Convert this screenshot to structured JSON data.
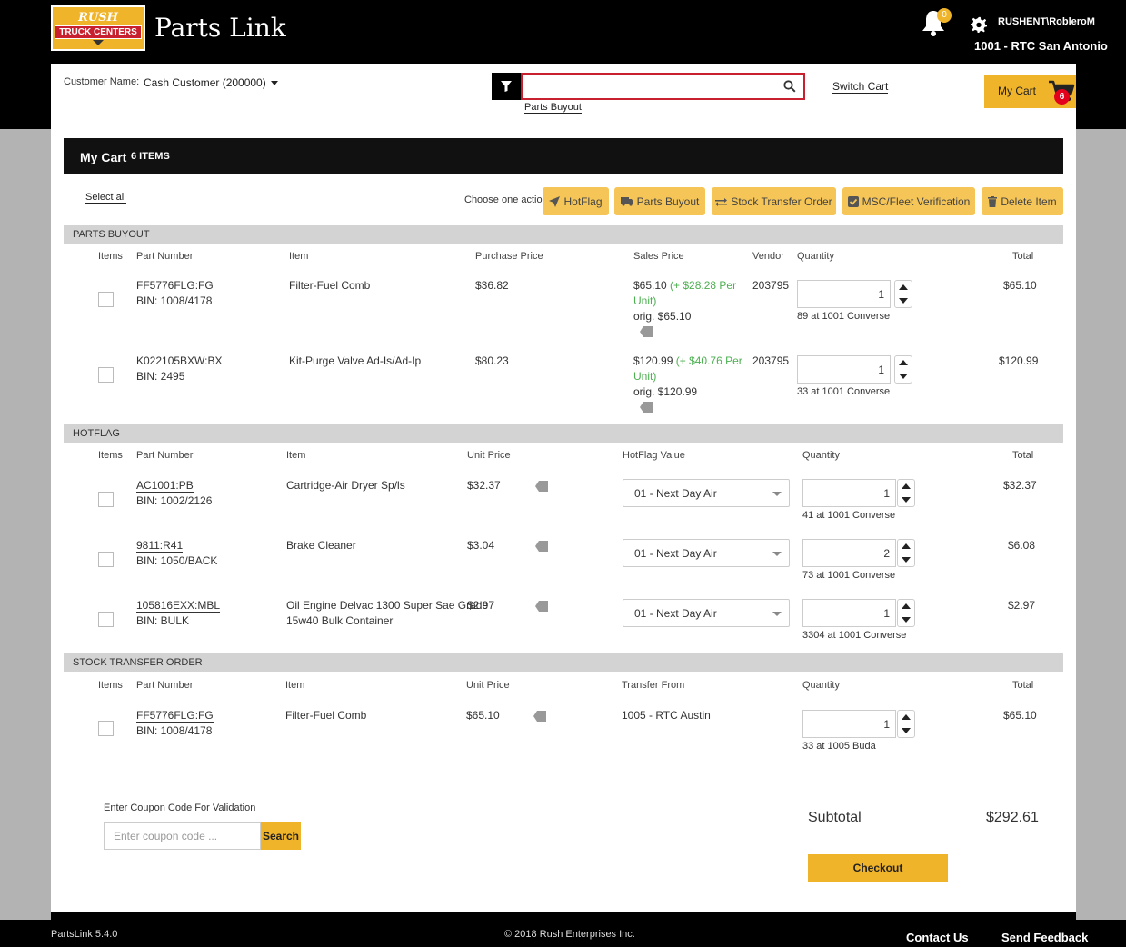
{
  "header": {
    "logo_top": "RUSH",
    "logo_bottom": "TRUCK CENTERS",
    "app_title": "Parts Link",
    "notification_count": "0",
    "username": "RUSHENT\\RobleroM",
    "location": "1001 - RTC San Antonio"
  },
  "subheader": {
    "customer_label": "Customer Name:",
    "customer_value": "Cash Customer (200000)",
    "search_value": "",
    "search_mode_link": "Parts Buyout",
    "switch_cart": "Switch Cart",
    "my_cart_label": "My Cart",
    "cart_count": "6"
  },
  "cart": {
    "title": "My Cart",
    "item_count": "6 ITEMS",
    "select_all": "Select all",
    "choose_action": "Choose one action:",
    "actions": [
      "HotFlag",
      "Parts Buyout",
      "Stock Transfer Order",
      "MSC/Fleet Verification",
      "Delete Item"
    ]
  },
  "parts_buyout": {
    "section_title": "PARTS BUYOUT",
    "headers": [
      "Items",
      "Part Number",
      "Item",
      "Purchase Price",
      "Sales Price",
      "Vendor",
      "Quantity",
      "Total"
    ],
    "rows": [
      {
        "part_number": "FF5776FLG:FG",
        "bin": "BIN: 1008/4178",
        "item": "Filter-Fuel Comb",
        "purchase_price": "$36.82",
        "sales_price": "$65.10",
        "markup": "(+ $28.28 Per",
        "markup_unit": "Unit)",
        "orig": "orig. $65.10",
        "vendor": "203795",
        "quantity": "1",
        "availability": "89 at 1001 Converse",
        "total": "$65.10"
      },
      {
        "part_number": "K022105BXW:BX",
        "bin": "BIN: 2495",
        "item": "Kit-Purge Valve Ad-Is/Ad-Ip",
        "purchase_price": "$80.23",
        "sales_price": "$120.99",
        "markup": "(+ $40.76 Per",
        "markup_unit": "Unit)",
        "orig": "orig. $120.99",
        "vendor": "203795",
        "quantity": "1",
        "availability": "33 at 1001 Converse",
        "total": "$120.99"
      }
    ]
  },
  "hotflag": {
    "section_title": "HOTFLAG",
    "headers": [
      "Items",
      "Part Number",
      "Item",
      "Unit Price",
      "HotFlag Value",
      "Quantity",
      "Total"
    ],
    "rows": [
      {
        "part_number": "AC1001:PB",
        "bin": "BIN: 1002/2126",
        "item": "Cartridge-Air Dryer Sp/ls",
        "item2": "",
        "unit_price": "$32.37",
        "hotflag_value": "01 - Next Day Air",
        "quantity": "1",
        "availability": "41 at 1001 Converse",
        "total": "$32.37"
      },
      {
        "part_number": "9811:R41",
        "bin": "BIN: 1050/BACK",
        "item": "Brake Cleaner",
        "item2": "",
        "unit_price": "$3.04",
        "hotflag_value": "01 - Next Day Air",
        "quantity": "2",
        "availability": "73 at 1001 Converse",
        "total": "$6.08"
      },
      {
        "part_number": "105816EXX:MBL",
        "bin": "BIN: BULK",
        "item": "Oil Engine Delvac 1300 Super Sae Grade",
        "item2": "15w40 Bulk Container",
        "unit_price": "$2.97",
        "hotflag_value": "01 - Next Day Air",
        "quantity": "1",
        "availability": "3304 at 1001 Converse",
        "total": "$2.97"
      }
    ]
  },
  "stock_transfer": {
    "section_title": "STOCK TRANSFER ORDER",
    "headers": [
      "Items",
      "Part Number",
      "Item",
      "Unit Price",
      "Transfer From",
      "Quantity",
      "Total"
    ],
    "rows": [
      {
        "part_number": "FF5776FLG:FG",
        "bin": "BIN: 1008/4178",
        "item": "Filter-Fuel Comb",
        "unit_price": "$65.10",
        "transfer_from": "1005 - RTC Austin",
        "quantity": "1",
        "availability": "33 at 1005 Buda",
        "total": "$65.10"
      }
    ]
  },
  "coupon": {
    "label": "Enter Coupon Code For Validation",
    "placeholder": "Enter coupon code ...",
    "button": "Search"
  },
  "summary": {
    "subtotal_label": "Subtotal",
    "subtotal_value": "$292.61",
    "checkout": "Checkout"
  },
  "footer": {
    "version": "PartsLink 5.4.0",
    "copyright": "© 2018 Rush Enterprises Inc.",
    "contact": "Contact Us",
    "feedback": "Send Feedback"
  },
  "colors": {
    "accent": "#f0b42a",
    "brand_red": "#c8202f",
    "markup_green": "#4caf50"
  }
}
